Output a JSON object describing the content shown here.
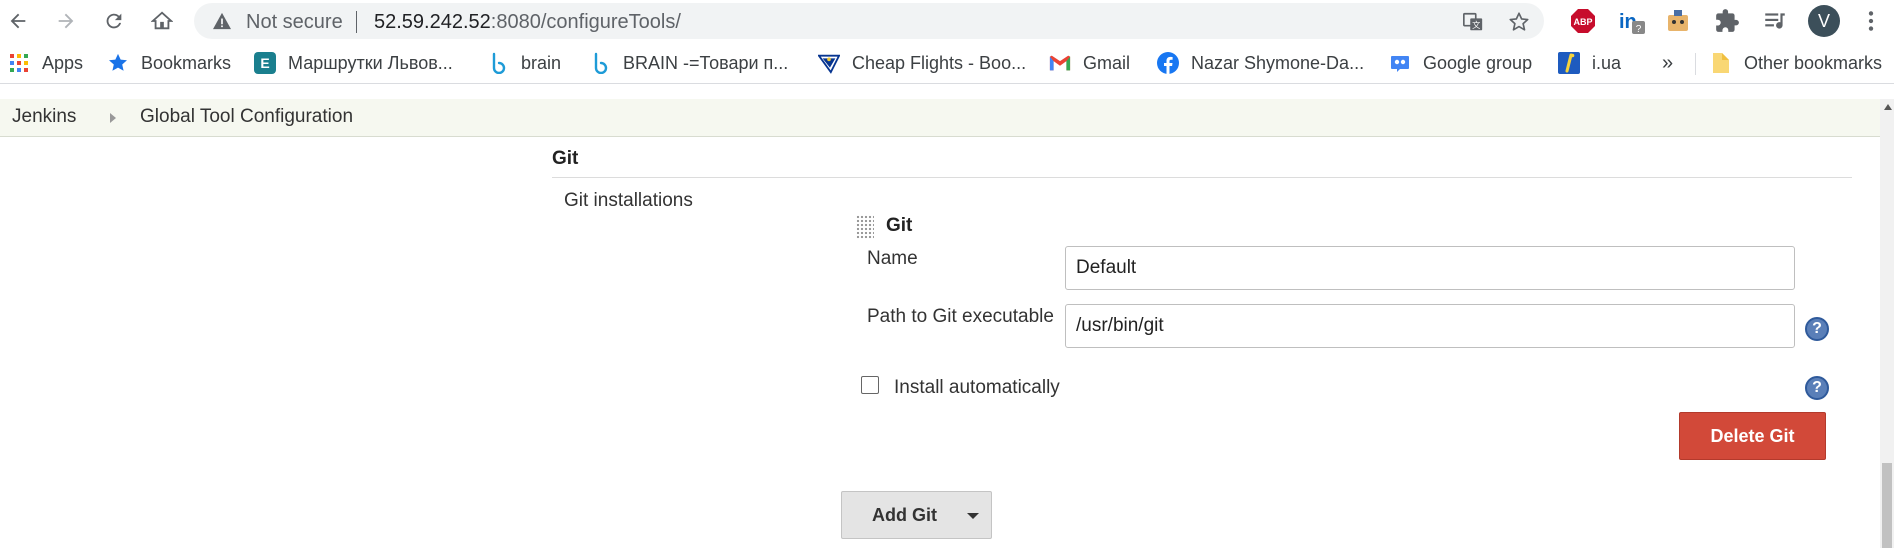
{
  "browser": {
    "security_label": "Not secure",
    "url_host": "52.59.242.52",
    "url_rest": ":8080/configureTools/",
    "avatar_initial": "V",
    "ext_abp_label": "ABP"
  },
  "bookmarks": {
    "items": [
      {
        "label": "Apps",
        "icon": "apps-grid-icon"
      },
      {
        "label": "Bookmarks",
        "icon": "star-icon"
      },
      {
        "label": "Маршрутки Львов...",
        "icon": "e-logo-icon"
      },
      {
        "label": "brain",
        "icon": "brain-logo-icon"
      },
      {
        "label": "BRAIN -=Товари п...",
        "icon": "brain-logo-icon"
      },
      {
        "label": "Cheap Flights - Boo...",
        "icon": "ryanair-logo-icon"
      },
      {
        "label": "Gmail",
        "icon": "gmail-icon"
      },
      {
        "label": "Nazar Shymone-Da...",
        "icon": "facebook-icon"
      },
      {
        "label": "Google group",
        "icon": "google-groups-icon"
      },
      {
        "label": "i.ua",
        "icon": "iua-icon"
      }
    ],
    "overflow": "»",
    "other": "Other bookmarks"
  },
  "breadcrumb": {
    "root": "Jenkins",
    "current": "Global Tool Configuration"
  },
  "git_section": {
    "title": "Git",
    "installations_label": "Git installations",
    "installation": {
      "header": "Git",
      "name_label": "Name",
      "name_value": "Default",
      "path_label": "Path to Git executable",
      "path_value": "/usr/bin/git",
      "install_auto_label": "Install automatically",
      "install_auto_checked": false,
      "delete_button": "Delete Git"
    },
    "add_button": "Add Git",
    "help_glyph": "?"
  },
  "colors": {
    "delete_button": "#d24939",
    "help_icon": "#5a7fb8",
    "breadcrumb_bg": "#f6f8f0"
  }
}
